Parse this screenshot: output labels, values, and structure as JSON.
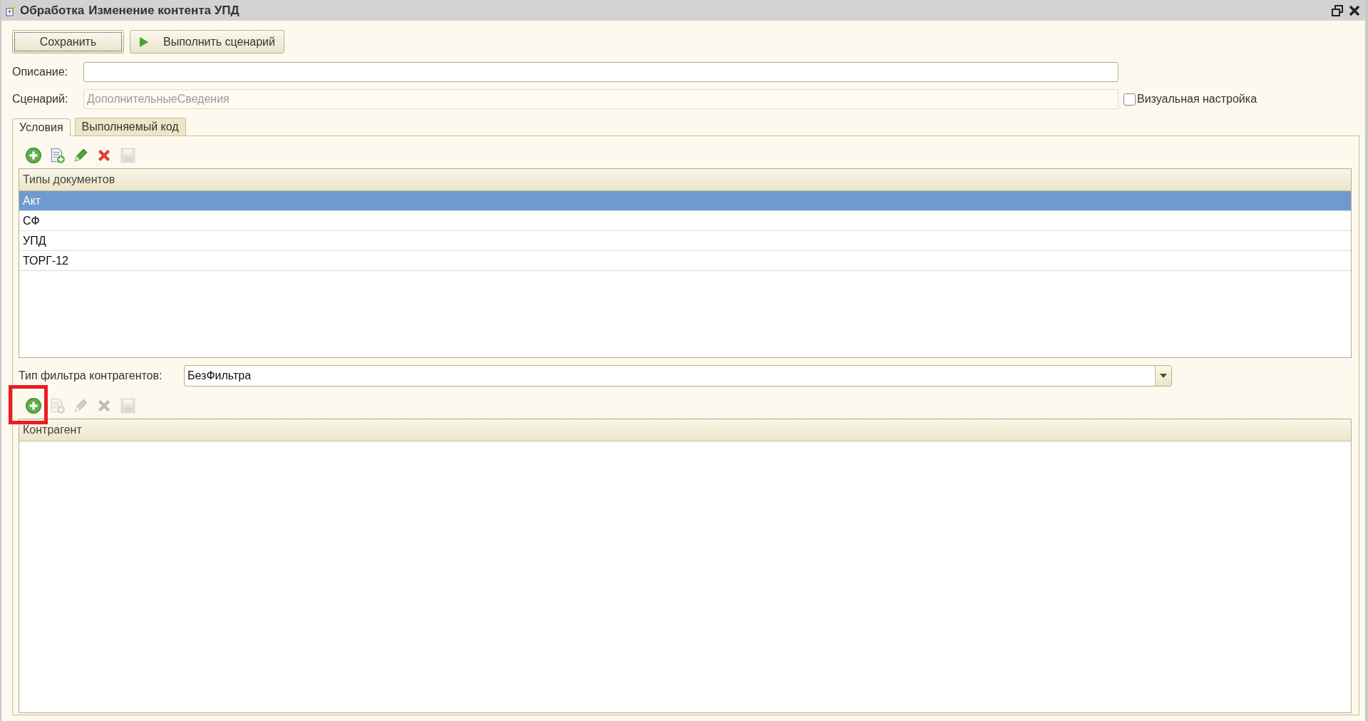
{
  "window": {
    "type_label": "Обработка",
    "title": "Изменение контента УПД"
  },
  "buttons": [
    {
      "label": "Сохранить",
      "kind": "default",
      "focused": true
    },
    {
      "label": "Выполнить сценарий",
      "kind": "run",
      "focused": false
    }
  ],
  "fields": [
    {
      "label": "Описание:",
      "disabled": false
    },
    {
      "label": "Сценарий:",
      "value": "ДополнительныеСведения",
      "disabled": true
    }
  ],
  "visual_setting": {
    "label": "Визуальная настройка",
    "checked": false
  },
  "tabs": [
    {
      "label": "Условия",
      "selected": true
    },
    {
      "label": "Выполняемый код",
      "selected": false
    }
  ],
  "doc_types": {
    "tools": [
      {
        "kind": "add",
        "disabled": false,
        "highlighted": false
      },
      {
        "kind": "copy",
        "disabled": false,
        "highlighted": false
      },
      {
        "kind": "edit",
        "disabled": false,
        "highlighted": false
      },
      {
        "kind": "delete",
        "disabled": false,
        "highlighted": false
      },
      {
        "kind": "save",
        "disabled": true,
        "highlighted": false
      }
    ],
    "columns": [
      "Типы документов"
    ],
    "rows": [
      {
        "cells": [
          "Акт"
        ],
        "selected": true
      },
      {
        "cells": [
          "СФ"
        ],
        "selected": false
      },
      {
        "cells": [
          "УПД"
        ],
        "selected": false
      },
      {
        "cells": [
          "ТОРГ-12"
        ],
        "selected": false
      }
    ]
  },
  "filter": {
    "label": "Тип фильтра контрагентов:",
    "value": "БезФильтра"
  },
  "counterparties": {
    "tools": [
      {
        "kind": "add",
        "disabled": false,
        "highlighted": true
      },
      {
        "kind": "copy",
        "disabled": true,
        "highlighted": false
      },
      {
        "kind": "edit",
        "disabled": true,
        "highlighted": false
      },
      {
        "kind": "delete",
        "disabled": true,
        "highlighted": false
      },
      {
        "kind": "save",
        "disabled": true,
        "highlighted": false
      }
    ],
    "columns": [
      "Контрагент"
    ]
  }
}
